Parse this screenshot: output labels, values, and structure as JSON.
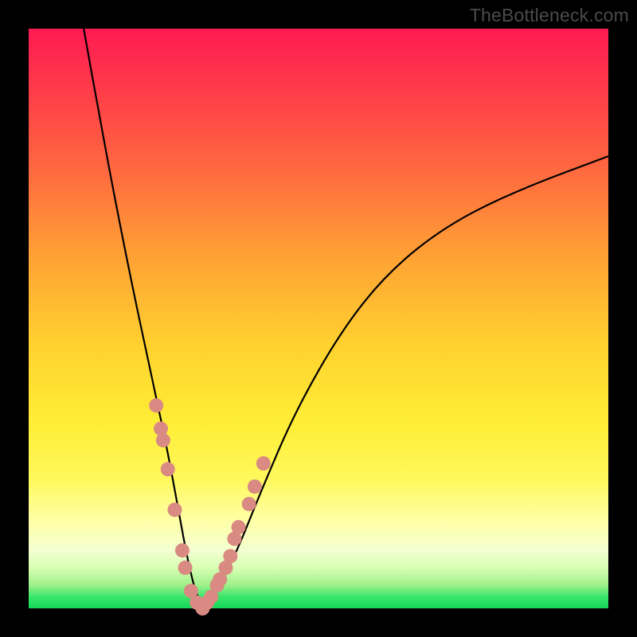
{
  "watermark": "TheBottleneck.com",
  "colors": {
    "frame": "#000000",
    "gradient_stops": [
      "#ff1a52",
      "#ff3a4a",
      "#ff6b3f",
      "#ffa434",
      "#ffd22f",
      "#ffee36",
      "#fff95e",
      "#ffffa8",
      "#f3ffd0",
      "#d8ffb3",
      "#9ff08a",
      "#39e66a",
      "#14d85a"
    ],
    "curve": "#000000",
    "markers": "#d98a82"
  },
  "chart_data": {
    "type": "line",
    "title": "",
    "xlabel": "",
    "ylabel": "",
    "xlim": [
      0,
      100
    ],
    "ylim": [
      0,
      100
    ],
    "note": "Rendered without visible axis ticks or labels; plot occupies inner area inside black frame. Heatmap gradient background with single V-shaped black curve + salmon markers near bottom. Values are estimated from pixel positions (y=0 at bottom, y=100 at top).",
    "series": [
      {
        "name": "bottleneck-curve",
        "x": [
          9.5,
          12,
          15,
          18,
          21,
          24,
          26,
          27.5,
          29,
          30.5,
          32,
          36,
          40,
          46,
          54,
          62,
          72,
          84,
          100
        ],
        "values": [
          100,
          86,
          70,
          55,
          41,
          27,
          16,
          8,
          2,
          0,
          2,
          10,
          20,
          34,
          48,
          58,
          66,
          72,
          78
        ]
      }
    ],
    "markers": {
      "name": "highlighted-points",
      "x": [
        22.0,
        22.8,
        23.2,
        24.0,
        25.2,
        26.5,
        27.0,
        28.0,
        29.0,
        30.0,
        30.8,
        31.5,
        32.5,
        33.0,
        34.0,
        34.8,
        35.5,
        36.2,
        38.0,
        39.0,
        40.5
      ],
      "values": [
        35,
        31,
        29,
        24,
        17,
        10,
        7,
        3,
        1,
        0,
        1,
        2,
        4,
        5,
        7,
        9,
        12,
        14,
        18,
        21,
        25
      ],
      "radius": 9
    }
  }
}
